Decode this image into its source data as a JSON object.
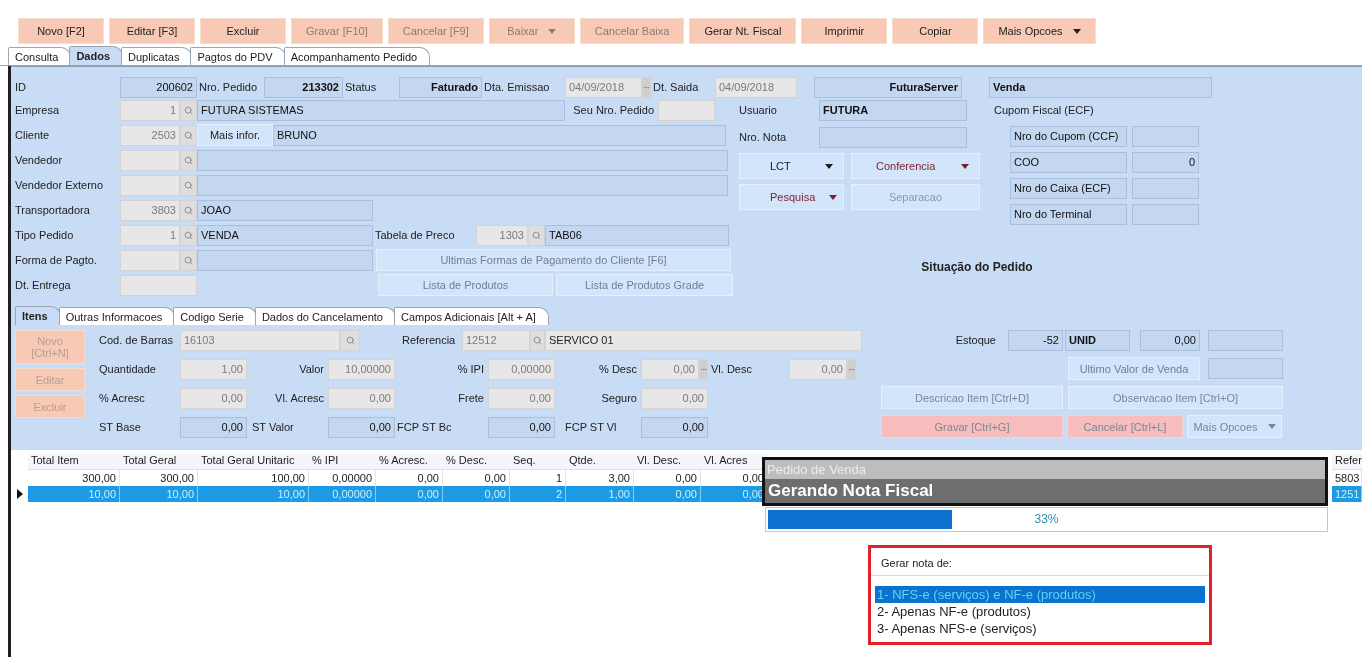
{
  "toolbar": [
    {
      "label": "Novo [F2]",
      "kind": "button",
      "disabled": false
    },
    {
      "label": "Editar [F3]",
      "kind": "button",
      "disabled": false
    },
    {
      "label": "Excluir",
      "kind": "button",
      "disabled": false
    },
    {
      "label": "Gravar [F10]",
      "kind": "button",
      "disabled": true
    },
    {
      "label": "Cancelar [F9]",
      "kind": "button",
      "disabled": true
    },
    {
      "label": "Baixar",
      "kind": "menu",
      "disabled": true
    },
    {
      "label": "Cancelar Baixa",
      "kind": "button",
      "disabled": true
    },
    {
      "label": "Gerar Nt. Fiscal",
      "kind": "button",
      "disabled": false
    },
    {
      "label": "Imprimir",
      "kind": "button",
      "disabled": false
    },
    {
      "label": "Copiar",
      "kind": "button",
      "disabled": false
    },
    {
      "label": "Mais Opcoes",
      "kind": "menu",
      "disabled": false
    }
  ],
  "tabs": [
    {
      "label": "Consulta",
      "selected": false
    },
    {
      "label": "Dados",
      "selected": true
    },
    {
      "label": "Duplicatas",
      "selected": false
    },
    {
      "label": "Pagtos do PDV",
      "selected": false
    },
    {
      "label": "Acompanhamento Pedido",
      "selected": false
    }
  ],
  "order": {
    "id_label": "ID",
    "id": "200602",
    "nro_pedido_label": "Nro. Pedido",
    "nro_pedido": "213302",
    "status_label": "Status",
    "status": "Faturado",
    "emissao_label": "Dta. Emissao",
    "emissao": "04/09/2018",
    "saida_label": "Dt. Saida",
    "saida": "04/09/2018",
    "server": "FuturaServer",
    "tipo": "Venda"
  },
  "empresa": {
    "label": "Empresa",
    "code": "1",
    "name": "FUTURA SISTEMAS"
  },
  "seu_nro_pedido": {
    "label": "Seu Nro. Pedido"
  },
  "cliente": {
    "label": "Cliente",
    "code": "2503",
    "button": "Mais infor.",
    "name": "BRUNO"
  },
  "vendedor": {
    "label": "Vendedor"
  },
  "vendedor_externo": {
    "label": "Vendedor Externo"
  },
  "transportadora": {
    "label": "Transportadora",
    "code": "3803",
    "name": "JOAO"
  },
  "tipo_pedido": {
    "label": "Tipo Pedido",
    "code": "1",
    "name": "VENDA"
  },
  "tabela_preco": {
    "label": "Tabela de Preco",
    "code": "1303",
    "name": "TAB06"
  },
  "forma_pagto": {
    "label": "Forma de Pagto."
  },
  "dt_entrega": {
    "label": "Dt. Entrega"
  },
  "order_buttons": [
    "Ultimas Formas de Pagamento do Cliente [F6]",
    "Lista de Produtos",
    "Lista de Produtos Grade"
  ],
  "usuario": {
    "label": "Usuario",
    "value": "FUTURA"
  },
  "nro_nota": {
    "label": "Nro. Nota"
  },
  "action_menus": [
    {
      "label": "LCT",
      "kind": "menu",
      "disabled": false,
      "color": "#1a1a1a"
    },
    {
      "label": "Conferencia",
      "kind": "menu",
      "disabled": false,
      "color": "#7a1f2b"
    },
    {
      "label": "Pesquisa",
      "kind": "menu",
      "disabled": false,
      "color": "#7a1f2b"
    },
    {
      "label": "Separacao",
      "kind": "button",
      "disabled": true
    }
  ],
  "cupom": {
    "title": "Cupom Fiscal (ECF)",
    "rows": [
      {
        "label": "Nro do Cupom (CCF)"
      },
      {
        "label": "COO",
        "value": "0"
      },
      {
        "label": "Nro do Caixa (ECF)"
      },
      {
        "label": "Nro do Terminal"
      }
    ]
  },
  "situacao": "Situação do Pedido",
  "item_tabs": [
    {
      "label": "Itens",
      "selected": true
    },
    {
      "label": "Outras Informacoes",
      "selected": false
    },
    {
      "label": "Codigo Serie",
      "selected": false
    },
    {
      "label": "Dados do Cancelamento",
      "selected": false
    },
    {
      "label": "Campos Adicionais [Alt + A]",
      "selected": false
    }
  ],
  "item_buttons": [
    {
      "label": "Novo [Ctrl+N]"
    },
    {
      "label": "Editar"
    },
    {
      "label": "Excluir"
    }
  ],
  "cod_barras": {
    "label": "Cod. de Barras",
    "value": "16103"
  },
  "referencia": {
    "label": "Referencia",
    "code": "12512",
    "name": "SERVICO 01"
  },
  "item_rows": [
    [
      {
        "label": "Quantidade",
        "value": "1,00",
        "kind": "input"
      },
      {
        "label": "Valor",
        "value": "10,00000",
        "kind": "input"
      },
      {
        "label": "% IPI",
        "value": "0,00000",
        "kind": "input"
      },
      {
        "label": "% Desc",
        "value": "0,00",
        "kind": "picker"
      },
      {
        "label": "Vl. Desc",
        "value": "0,00",
        "kind": "picker"
      }
    ],
    [
      {
        "label": "% Acresc",
        "value": "0,00",
        "kind": "input"
      },
      {
        "label": "Vl. Acresc",
        "value": "0,00",
        "kind": "input"
      },
      {
        "label": "Frete",
        "value": "0,00",
        "kind": "input"
      },
      {
        "label": "Seguro",
        "value": "0,00",
        "kind": "input"
      }
    ],
    [
      {
        "label": "ST Base",
        "value": "0,00",
        "kind": "readonly"
      },
      {
        "label": "ST Valor",
        "value": "0,00",
        "kind": "readonly"
      },
      {
        "label": "FCP ST Bc",
        "value": "0,00",
        "kind": "readonly"
      },
      {
        "label": "FCP ST Vl",
        "value": "0,00",
        "kind": "readonly"
      }
    ]
  ],
  "estoque": {
    "label": "Estoque",
    "value": "-52",
    "unit": "UNID",
    "price": "0,00"
  },
  "ultimo_valor": "Ultimo Valor de Venda",
  "item_actions": [
    {
      "label": "Descricao Item [Ctrl+D]",
      "kind": "soft"
    },
    {
      "label": "Observacao Item [Ctrl+O]",
      "kind": "soft"
    },
    {
      "label": "Gravar [Ctrl+G]",
      "kind": "save"
    },
    {
      "label": "Cancelar [Ctrl+L]",
      "kind": "save"
    },
    {
      "label": "Mais Opcoes",
      "kind": "menu"
    }
  ],
  "table": {
    "columns": [
      "Total Item",
      "Total Geral",
      "Total Geral Unitaric",
      "% IPI",
      "% Acresc.",
      "% Desc.",
      "Seq.",
      "Qtde.",
      "Vl. Desc.",
      "Vl. Acres",
      "Refer"
    ],
    "rows": [
      {
        "selected": false,
        "cells": [
          "300,00",
          "300,00",
          "100,00",
          "0,00000",
          "0,00",
          "0,00",
          "1",
          "3,00",
          "0,00",
          "0,00",
          "5803"
        ]
      },
      {
        "selected": true,
        "cells": [
          "10,00",
          "10,00",
          "10,00",
          "0,00000",
          "0,00",
          "0,00",
          "2",
          "1,00",
          "0,00",
          "0,00",
          "1251"
        ]
      }
    ]
  },
  "progress": {
    "title": "Pedido de Venda",
    "message": "Gerando Nota Fiscal",
    "level": 0.33,
    "reading": "33%"
  },
  "choice": {
    "title": "Gerar nota de:",
    "options": [
      {
        "label": "1- NFS-e (serviços) e NF-e (produtos)",
        "selected": true
      },
      {
        "label": "2- Apenas NF-e (produtos)",
        "selected": false
      },
      {
        "label": "3- Apenas NFS-e (serviços)",
        "selected": false
      }
    ]
  }
}
